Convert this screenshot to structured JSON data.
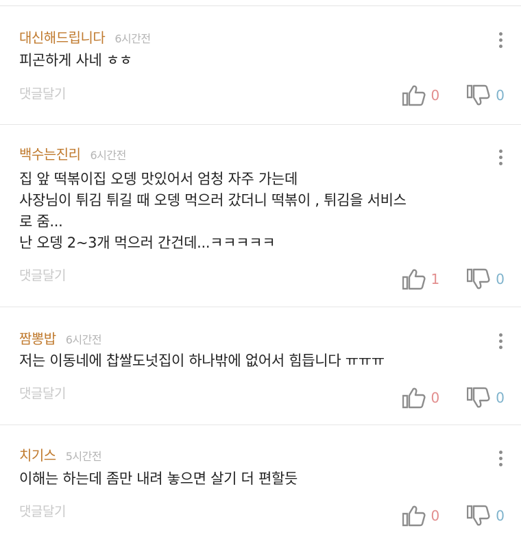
{
  "reply_label": "댓글달기",
  "comments": [
    {
      "author": "대신해드립니다",
      "time": "6시간전",
      "lines": [
        "피곤하게 사네 ㅎㅎ"
      ],
      "likes": "0",
      "dislikes": "0"
    },
    {
      "author": "백수는진리",
      "time": "6시간전",
      "lines": [
        "집 앞 떡볶이집 오뎅 맛있어서 엄청 자주 가는데",
        "사장님이 튀김 튀길 때 오뎅 먹으러 갔더니 떡볶이 , 튀김을 서비스",
        "로 줌...",
        "난 오뎅 2~3개 먹으러 간건데...ㅋㅋㅋㅋㅋ"
      ],
      "likes": "1",
      "dislikes": "0"
    },
    {
      "author": "짬뽕밥",
      "time": "6시간전",
      "lines": [
        "저는 이동네에 찹쌀도넛집이 하나밖에 없어서 힘듭니다 ㅠㅠㅠ"
      ],
      "likes": "0",
      "dislikes": "0"
    },
    {
      "author": "치기스",
      "time": "5시간전",
      "lines": [
        "이해는 하는데 좀만 내려 놓으면 살기 더 편할듯"
      ],
      "likes": "0",
      "dislikes": "0"
    }
  ],
  "colors": {
    "author": "#c07a2e",
    "like_count": "#e28e8e",
    "dislike_count": "#7fb3cc"
  },
  "icons": [
    "more-vertical-icon",
    "thumbs-up-icon",
    "thumbs-down-icon"
  ]
}
